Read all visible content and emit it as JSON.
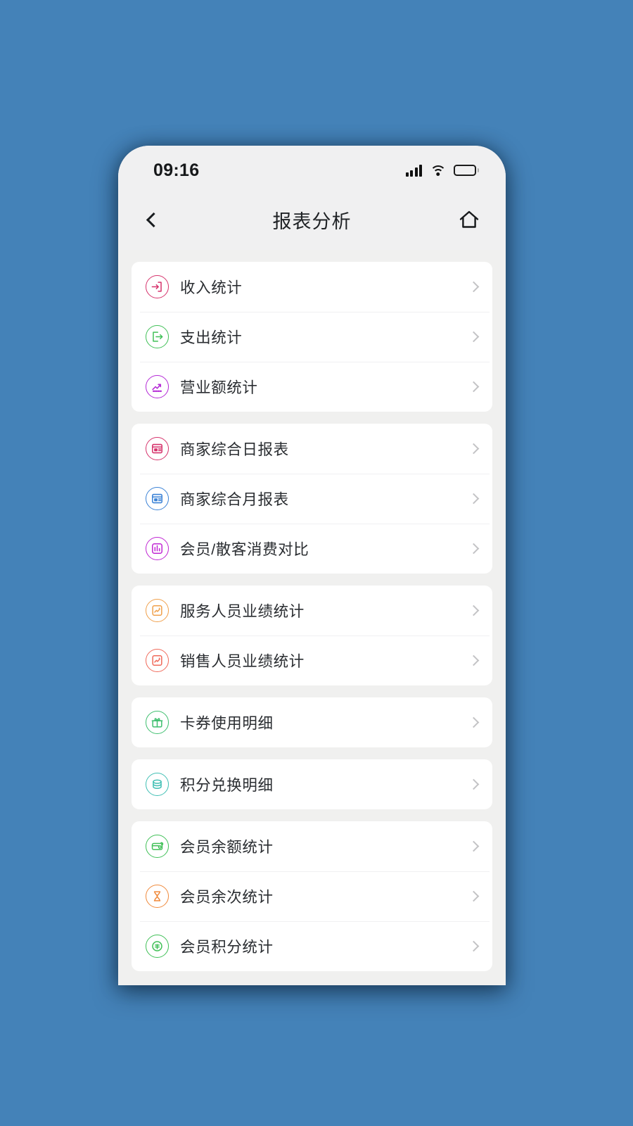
{
  "theme": {
    "backdrop": "#4482b8",
    "phone_bg": "#f0f0ef",
    "header_bg": "#f0f0f1",
    "card_bg": "#ffffff",
    "label_color": "#2a2d31",
    "chevron_color": "#c3c3c5"
  },
  "status_bar": {
    "time": "09:16",
    "signal_icon": "signal-bars-icon",
    "wifi_icon": "wifi-icon",
    "battery_icon": "battery-icon",
    "battery_level": 45
  },
  "nav": {
    "back_icon": "chevron-left-icon",
    "title": "报表分析",
    "home_icon": "home-icon"
  },
  "groups": [
    {
      "items": [
        {
          "label": "收入统计",
          "icon": "income-arrow-in-icon",
          "color": "#d6336c",
          "chevron": "chevron-right-icon"
        },
        {
          "label": "支出统计",
          "icon": "expense-arrow-out-icon",
          "color": "#40c057",
          "chevron": "chevron-right-icon"
        },
        {
          "label": "营业额统计",
          "icon": "trend-chart-icon",
          "color": "#b429d6",
          "chevron": "chevron-right-icon"
        }
      ]
    },
    {
      "items": [
        {
          "label": "商家综合日报表",
          "icon": "daily-report-icon",
          "color": "#d6336c",
          "chevron": "chevron-right-icon"
        },
        {
          "label": "商家综合月报表",
          "icon": "monthly-report-icon",
          "color": "#3b82d6",
          "chevron": "chevron-right-icon"
        },
        {
          "label": "会员/散客消费对比",
          "icon": "compare-consumption-icon",
          "color": "#c026d3",
          "chevron": "chevron-right-icon"
        }
      ]
    },
    {
      "items": [
        {
          "label": "服务人员业绩统计",
          "icon": "service-staff-performance-icon",
          "color": "#f0a04b",
          "chevron": "chevron-right-icon"
        },
        {
          "label": "销售人员业绩统计",
          "icon": "sales-staff-performance-icon",
          "color": "#f06a5a",
          "chevron": "chevron-right-icon"
        }
      ]
    },
    {
      "items": [
        {
          "label": "卡券使用明细",
          "icon": "gift-card-icon",
          "color": "#3fbf6f",
          "chevron": "chevron-right-icon"
        }
      ]
    },
    {
      "items": [
        {
          "label": "积分兑换明细",
          "icon": "coins-stack-icon",
          "color": "#40bfb4",
          "chevron": "chevron-right-icon"
        }
      ]
    },
    {
      "items": [
        {
          "label": "会员余额统计",
          "icon": "member-balance-icon",
          "color": "#40c057",
          "chevron": "chevron-right-icon"
        },
        {
          "label": "会员余次统计",
          "icon": "hourglass-icon",
          "color": "#f08a3c",
          "chevron": "chevron-right-icon"
        },
        {
          "label": "会员积分统计",
          "icon": "member-points-icon",
          "color": "#40c057",
          "chevron": "chevron-right-icon"
        }
      ]
    }
  ]
}
